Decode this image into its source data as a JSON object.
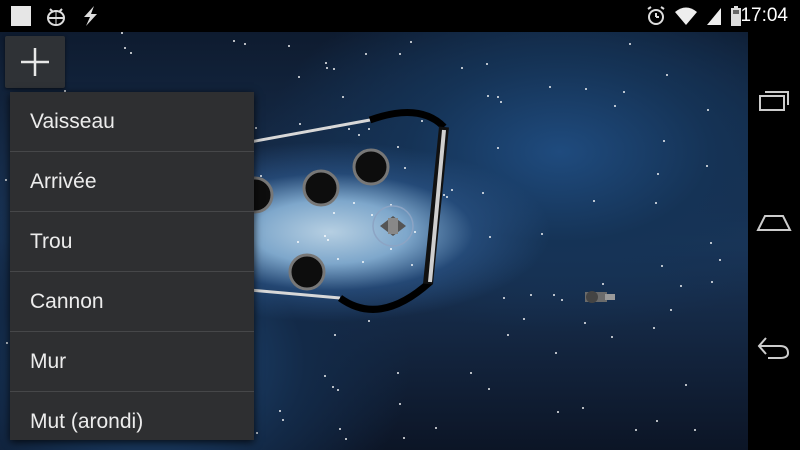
{
  "status_bar": {
    "time": "17:04",
    "left_icons": [
      "square-icon",
      "android-bug-icon",
      "flash-icon"
    ],
    "right_icons": [
      "alarm-icon",
      "wifi-icon",
      "signal-icon",
      "battery-icon"
    ]
  },
  "toolbar": {
    "add_icon": "plus-icon"
  },
  "menu": {
    "items": [
      {
        "label": "Vaisseau"
      },
      {
        "label": "Arrivée"
      },
      {
        "label": "Trou"
      },
      {
        "label": "Cannon"
      },
      {
        "label": "Mur"
      },
      {
        "label": "Mut (arondi)"
      }
    ]
  },
  "nav_bar": {
    "icons": [
      "recent-apps-icon",
      "home-icon",
      "back-icon"
    ]
  },
  "colors": {
    "menu_bg": "#2e2f31",
    "menu_divider": "#464749",
    "menu_text": "#ececec",
    "space_dark": "#0e1b2f",
    "nebula": "#b6cfe2"
  }
}
